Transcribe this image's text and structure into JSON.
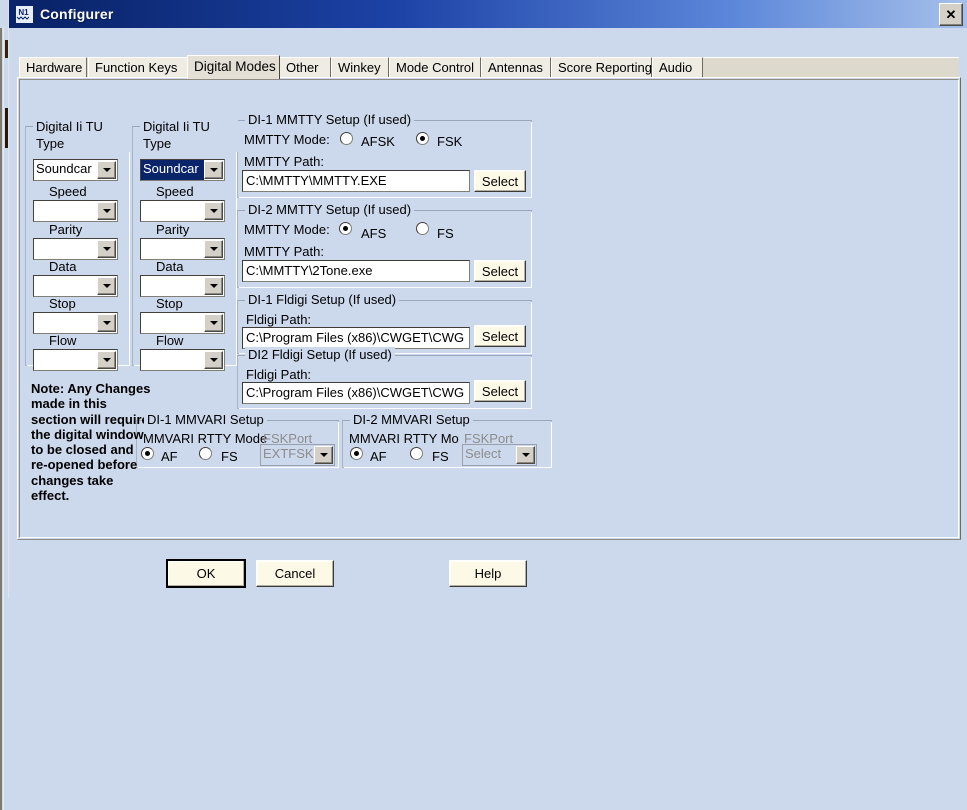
{
  "window": {
    "title": "Configurer",
    "app_icon": "n1mm-logo-icon",
    "close_label": "✕"
  },
  "tabs": [
    {
      "label": "Hardware",
      "selected": false
    },
    {
      "label": "Function Keys",
      "selected": false
    },
    {
      "label": "Digital Modes",
      "selected": true
    },
    {
      "label": "Other",
      "selected": false
    },
    {
      "label": "Winkey",
      "selected": false
    },
    {
      "label": "Mode Control",
      "selected": false
    },
    {
      "label": "Antennas",
      "selected": false
    },
    {
      "label": "Score Reporting",
      "selected": false
    },
    {
      "label": "Audio",
      "selected": false
    }
  ],
  "digital1": {
    "legend": "Digital Ii TU Type",
    "tu_type_value": "Soundcar",
    "tu_type_selected": false,
    "fields": [
      {
        "label": "Speed",
        "value": ""
      },
      {
        "label": "Parity",
        "value": ""
      },
      {
        "label": "Data",
        "value": ""
      },
      {
        "label": "Stop",
        "value": ""
      },
      {
        "label": "Flow",
        "value": ""
      }
    ]
  },
  "digital2": {
    "legend": "Digital Ii TU Type",
    "tu_type_value": "Soundcar",
    "tu_type_selected": true,
    "fields": [
      {
        "label": "Speed",
        "value": ""
      },
      {
        "label": "Parity",
        "value": ""
      },
      {
        "label": "Data",
        "value": ""
      },
      {
        "label": "Stop",
        "value": ""
      },
      {
        "label": "Flow",
        "value": ""
      }
    ]
  },
  "di1_mmtty": {
    "legend": "DI-1 MMTTY Setup (If used)",
    "mode_label": "MMTTY Mode:",
    "opt1": "AFSK",
    "opt2": "FSK",
    "opt1_selected": false,
    "opt2_selected": true,
    "path_label": "MMTTY Path:",
    "path_value": "C:\\MMTTY\\MMTTY.EXE",
    "select_label": "Select"
  },
  "di2_mmtty": {
    "legend": "DI-2 MMTTY Setup (If used)",
    "mode_label": "MMTTY Mode:",
    "opt1": "AFS",
    "opt2": "FS",
    "opt1_selected": true,
    "opt2_selected": false,
    "path_label": "MMTTY Path:",
    "path_value": "C:\\MMTTY\\2Tone.exe",
    "select_label": "Select"
  },
  "di1_fldigi": {
    "legend": "DI-1 Fldigi Setup (If used)",
    "path_label": "Fldigi Path:",
    "path_value": "C:\\Program Files (x86)\\CWGET\\CWG",
    "select_label": "Select"
  },
  "di2_fldigi": {
    "legend": "DI2 Fldigi Setup (If used)",
    "path_label": "Fldigi Path:",
    "path_value": "C:\\Program Files (x86)\\CWGET\\CWG",
    "select_label": "Select"
  },
  "di1_mmvari": {
    "legend": "DI-1 MMVARI Setup",
    "mode_label": "MMVARI RTTY Mode",
    "fskport_label": "FSKPort",
    "opt1": "AF",
    "opt2": "FS",
    "opt1_selected": true,
    "opt2_selected": false,
    "port_value": "EXTFSK"
  },
  "di2_mmvari": {
    "legend": "DI-2 MMVARI Setup",
    "mode_label": "MMVARI RTTY Mo",
    "fskport_label": "FSKPort",
    "opt1": "AF",
    "opt2": "FS",
    "opt1_selected": true,
    "opt2_selected": false,
    "port_value": "Select"
  },
  "note": {
    "text": "Note: Any Changes made in this section will require the digital window to be closed and re-opened before changes take effect."
  },
  "buttons": {
    "ok": "OK",
    "cancel": "Cancel",
    "help": "Help"
  },
  "colors": {
    "background": "#ccd8ec",
    "titlebar": "#0a246a",
    "selection": "#0a246a",
    "button_face": "#fdf9e7",
    "disabled_text": "#8d8d8d"
  }
}
